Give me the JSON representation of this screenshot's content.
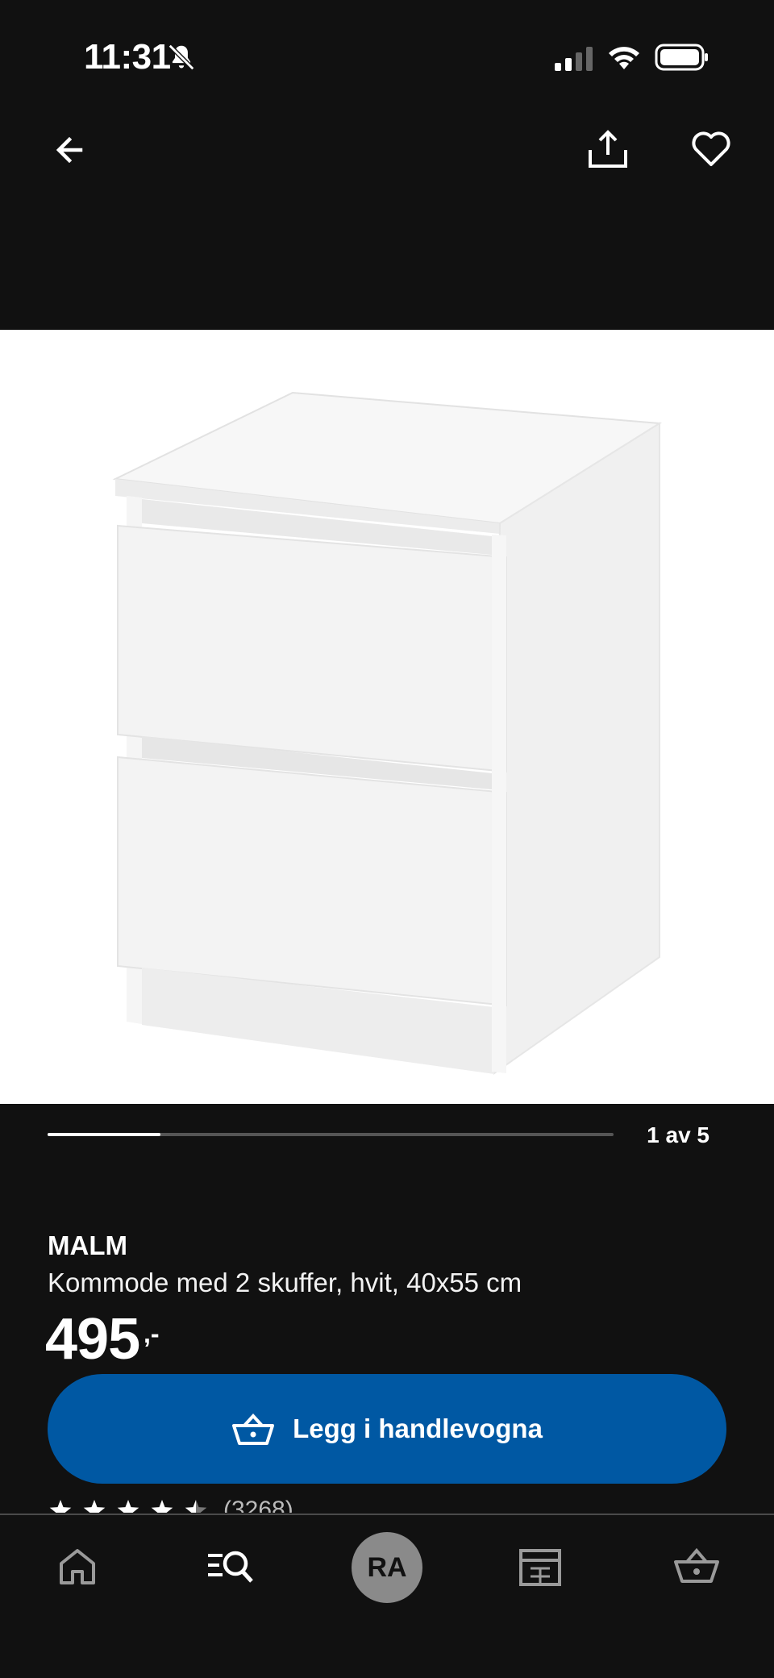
{
  "status_bar": {
    "time": "11:31",
    "icons": [
      "bell-muted-icon",
      "signal-icon",
      "wifi-icon",
      "battery-icon"
    ]
  },
  "header": {
    "back_icon": "arrow-left-icon",
    "share_icon": "share-icon",
    "favorite_icon": "heart-icon"
  },
  "carousel": {
    "counter": "1 av 5",
    "current": 1,
    "total": 5
  },
  "product": {
    "brand": "MALM",
    "description": "Kommode med 2 skuffer, hvit, 40x55 cm",
    "price": "495",
    "price_suffix": ",-",
    "rating_value": 4.5,
    "rating_count": "(3268)"
  },
  "add_to_cart": {
    "label": "Legg i handlevogna",
    "icon": "shopping-basket-icon"
  },
  "bottom_nav": {
    "items": [
      "home-icon",
      "search-icon",
      "avatar",
      "store-icon",
      "basket-icon"
    ],
    "avatar_initials": "RA"
  },
  "colors": {
    "background": "#111111",
    "primary_button": "#0058a3",
    "text": "#ffffff"
  }
}
